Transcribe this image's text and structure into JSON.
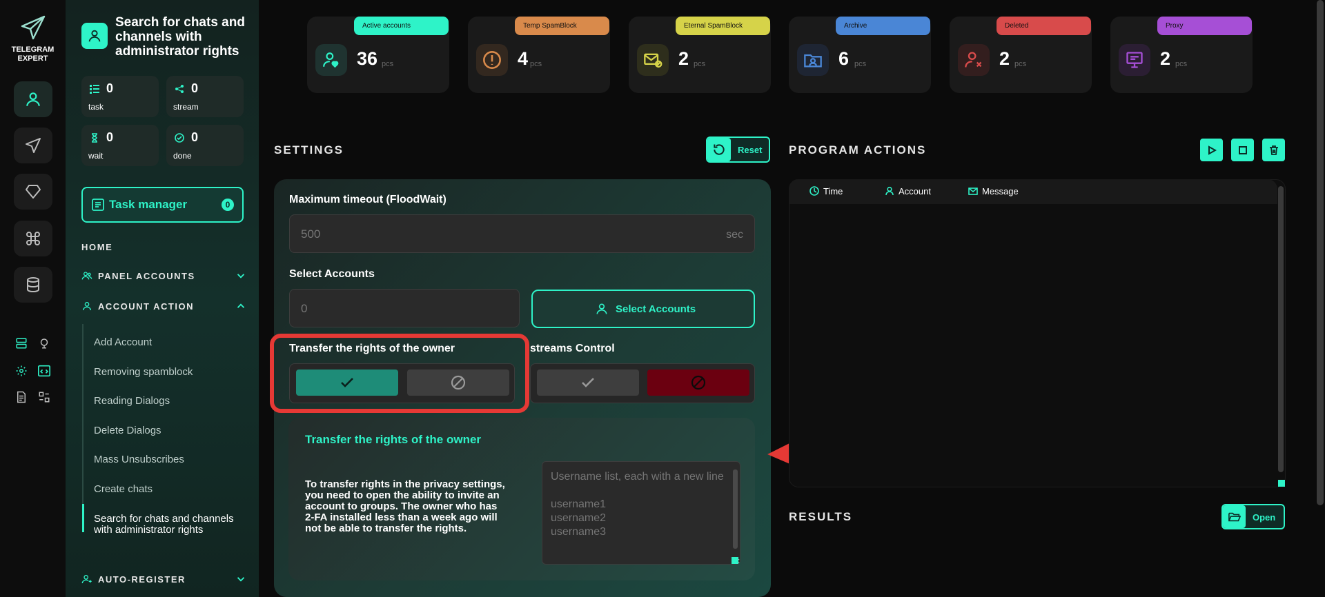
{
  "app": {
    "logo_text": "TELEGRAM EXPERT"
  },
  "sidebar": {
    "title": "Search for chats and channels with administrator rights",
    "stats": [
      {
        "value": "0",
        "label": "task"
      },
      {
        "value": "0",
        "label": "stream"
      },
      {
        "value": "0",
        "label": "wait"
      },
      {
        "value": "0",
        "label": "done"
      }
    ],
    "task_manager": {
      "label": "Task manager",
      "count": "0"
    },
    "home_label": "HOME",
    "groups": {
      "panel_accounts": "PANEL ACCOUNTS",
      "account_action": "ACCOUNT ACTION",
      "auto_register": "AUTO-REGISTER"
    },
    "sub_items": [
      "Add Account",
      "Removing spamblock",
      "Reading Dialogs",
      "Delete Dialogs",
      "Mass Unsubscribes",
      "Create chats",
      "Search for chats and channels with administrator rights"
    ]
  },
  "top_stats": [
    {
      "label": "Active accounts",
      "value": "36",
      "unit": "pcs",
      "color": "#2ef3c8"
    },
    {
      "label": "Temp SpamBlock",
      "value": "4",
      "unit": "pcs",
      "color": "#d98a4b"
    },
    {
      "label": "Eternal SpamBlock",
      "value": "2",
      "unit": "pcs",
      "color": "#d6d349"
    },
    {
      "label": "Archive",
      "value": "6",
      "unit": "pcs",
      "color": "#4a86d6"
    },
    {
      "label": "Deleted",
      "value": "2",
      "unit": "pcs",
      "color": "#d84b4b"
    },
    {
      "label": "Proxy",
      "value": "2",
      "unit": "pcs",
      "color": "#a64fd6"
    }
  ],
  "settings": {
    "title": "SETTINGS",
    "reset_label": "Reset",
    "timeout_label": "Maximum timeout (FloodWait)",
    "timeout_value": "500",
    "timeout_unit": "sec",
    "select_accounts_label": "Select Accounts",
    "select_accounts_value": "0",
    "select_accounts_button": "Select Accounts",
    "transfer_label": "Transfer the rights of the owner",
    "streams_label": "streams Control",
    "info_title": "Transfer the rights of the owner",
    "info_text": "To transfer rights in the privacy settings, you need to open the ability to invite an account to groups. The owner who has 2-FA installed less than a week ago will not be able to transfer the rights.",
    "usernames_placeholder": "Username list, each with a new line\n\nusername1\nusername2\nusername3"
  },
  "program_actions": {
    "title": "PROGRAM ACTIONS",
    "columns": [
      "Time",
      "Account",
      "Message"
    ]
  },
  "results": {
    "title": "RESULTS",
    "open_label": "Open"
  }
}
